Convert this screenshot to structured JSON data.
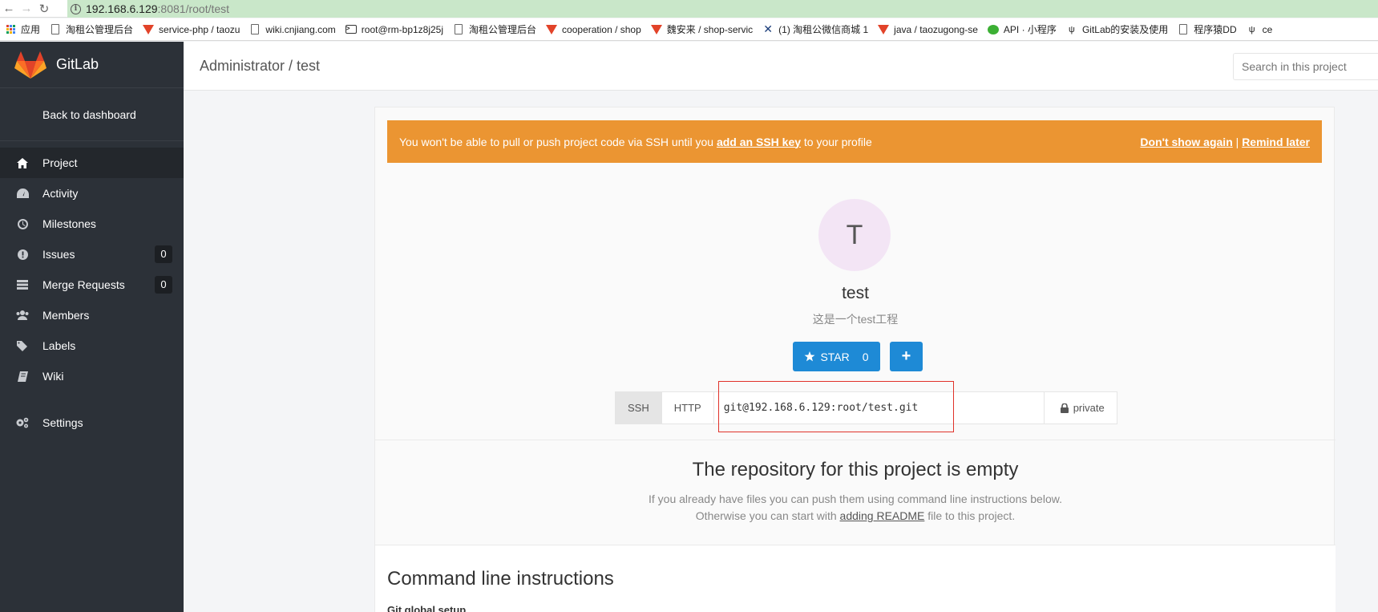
{
  "browser": {
    "url_host": "192.168.6.129",
    "url_path": ":8081/root/test",
    "bookmarks": [
      {
        "icon": "apps-grid-icon",
        "label": "应用"
      },
      {
        "icon": "document-icon",
        "label": "淘租公管理后台"
      },
      {
        "icon": "gitlab-icon",
        "label": "service-php / taozu"
      },
      {
        "icon": "document-icon",
        "label": "wiki.cnjiang.com"
      },
      {
        "icon": "terminal-icon",
        "label": "root@rm-bp1z8j25j"
      },
      {
        "icon": "document-icon",
        "label": "淘租公管理后台"
      },
      {
        "icon": "gitlab-icon",
        "label": "cooperation / shop"
      },
      {
        "icon": "gitlab-icon",
        "label": "魏安来 / shop-servic"
      },
      {
        "icon": "x-icon",
        "label": "(1) 淘租公微信商城 1"
      },
      {
        "icon": "gitlab-icon",
        "label": "java / taozugong-se"
      },
      {
        "icon": "wechat-icon",
        "label": "API · 小程序"
      },
      {
        "icon": "gitlab-outline-icon",
        "label": "GitLab的安装及使用"
      },
      {
        "icon": "document-icon",
        "label": "程序猿DD"
      },
      {
        "icon": "gitlab-outline-icon",
        "label": "ce"
      }
    ]
  },
  "sidebar": {
    "brand": "GitLab",
    "back_label": "Back to dashboard",
    "items": [
      {
        "label": "Project",
        "icon": "home-icon",
        "active": true
      },
      {
        "label": "Activity",
        "icon": "dashboard-icon"
      },
      {
        "label": "Milestones",
        "icon": "clock-icon"
      },
      {
        "label": "Issues",
        "icon": "exclamation-circle-icon",
        "count": "0"
      },
      {
        "label": "Merge Requests",
        "icon": "tasks-icon",
        "count": "0"
      },
      {
        "label": "Members",
        "icon": "users-icon"
      },
      {
        "label": "Labels",
        "icon": "tags-icon"
      },
      {
        "label": "Wiki",
        "icon": "book-icon"
      },
      {
        "label": "Settings",
        "icon": "cogs-icon"
      }
    ]
  },
  "header": {
    "breadcrumb": "Administrator / test",
    "search_placeholder": "Search in this project"
  },
  "alert": {
    "text_before": "You won't be able to pull or push project code via SSH until you ",
    "link": "add an SSH key",
    "text_after": " to your profile",
    "dont_show": "Don't show again",
    "separator": " | ",
    "remind": "Remind later",
    "color": "#eb9532"
  },
  "project": {
    "avatar_letter": "T",
    "name": "test",
    "description": "这是一个test工程",
    "star_label": "STAR",
    "star_count": "0",
    "add_label": "+"
  },
  "clone": {
    "ssh_label": "SSH",
    "http_label": "HTTP",
    "url": "git@192.168.6.129:root/test.git",
    "visibility": "private"
  },
  "empty": {
    "title": "The repository for this project is empty",
    "line1": "If you already have files you can push them using command line instructions below.",
    "line2_before": "Otherwise you can start with ",
    "line2_link": "adding README",
    "line2_after": " file to this project."
  },
  "cli": {
    "title": "Command line instructions",
    "subtitle": "Git global setup"
  },
  "colors": {
    "sidebar_bg": "#2c3138",
    "primary_button": "#1e8ad6",
    "highlight_box": "#e0322a"
  }
}
